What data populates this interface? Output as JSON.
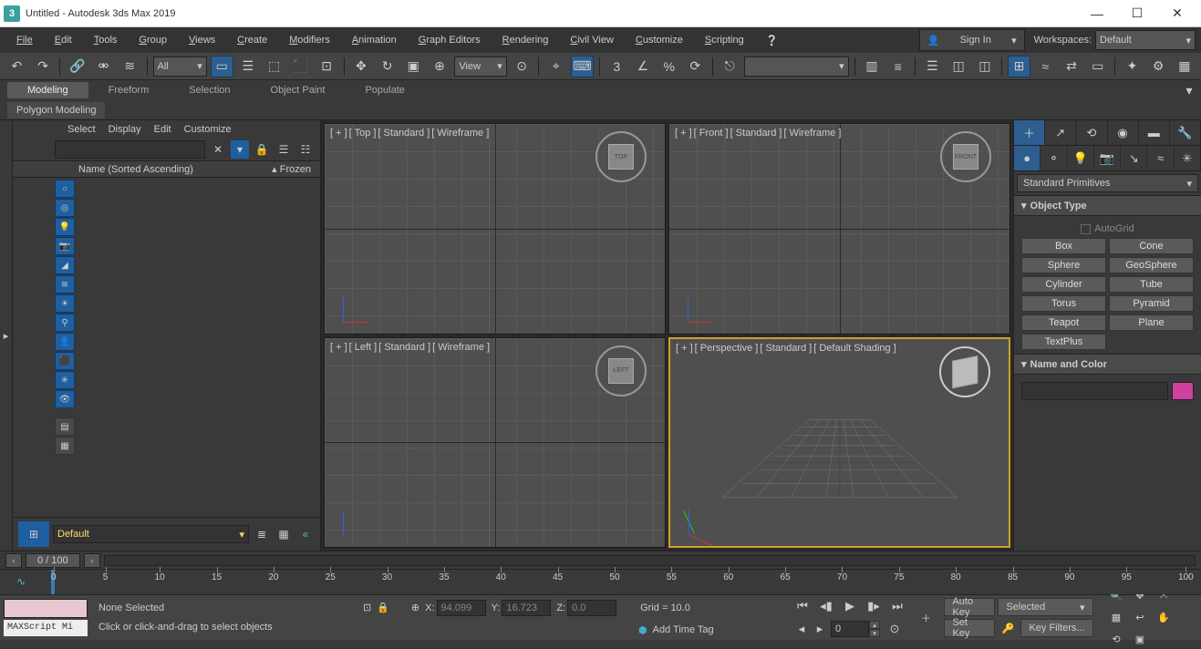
{
  "titlebar": {
    "app_icon": "3",
    "title": "Untitled - Autodesk 3ds Max 2019",
    "min": "—",
    "max": "☐",
    "close": "✕"
  },
  "menubar": {
    "items": [
      "File",
      "Edit",
      "Tools",
      "Group",
      "Views",
      "Create",
      "Modifiers",
      "Animation",
      "Graph Editors",
      "Rendering",
      "Civil View",
      "Customize",
      "Scripting"
    ],
    "help_icon": "❔",
    "signin": "Sign In",
    "ws_label": "Workspaces:",
    "ws_value": "Default"
  },
  "toolbar": {
    "undo": "↶",
    "redo": "↷",
    "link": "🔗",
    "unlink": "⚮",
    "bind": "≋",
    "filter_drop": "All",
    "select": "▭",
    "select_name": "☰",
    "rect": "⬚",
    "window": "⬛",
    "crossing": "⊡",
    "move": "✥",
    "rotate": "↻",
    "scale": "▣",
    "refcoord": "View",
    "pivot": "⊙",
    "snap_t": "⌖",
    "snap3": "3",
    "angle": "∠",
    "percent": "%",
    "spinner": "⟳",
    "curve": "⎋",
    "mirror": "▥",
    "align": "≡",
    "layers": "☰",
    "schematic": "◫",
    "material": "◐",
    "render_set": "⚙",
    "render_frame": "▭",
    "render": "▶",
    "r1": "◫",
    "r2": "≈",
    "r3": "⇄",
    "r4": "⊞",
    "r5": "✦",
    "r6": "⚙",
    "r7": "▦"
  },
  "ribbon": {
    "tabs": [
      "Modeling",
      "Freeform",
      "Selection",
      "Object Paint",
      "Populate"
    ],
    "panel": "Polygon Modeling",
    "drop_icon": "▾"
  },
  "scene_explorer": {
    "menu": [
      "Select",
      "Display",
      "Edit",
      "Customize"
    ],
    "search_ph": "",
    "clear": "✕",
    "filter": "▾",
    "lock": "🔒",
    "i1": "☰",
    "i2": "☷",
    "col_name": "Name (Sorted Ascending)",
    "col_frozen_arrow": "▴",
    "col_frozen": "Frozen",
    "left_icons": [
      "○",
      "◎",
      "💡",
      "📷",
      "◢",
      "≋",
      "☀",
      "⚲",
      "👤",
      "⬛",
      "✳",
      "👁",
      "",
      "▤",
      "▦"
    ],
    "expand": "▸",
    "vp_toggle": "⊞",
    "layer_value": "Default",
    "bi1": "≣",
    "bi2": "▦",
    "collapse": "«"
  },
  "viewports": {
    "v0": {
      "labels": [
        "[ + ]",
        "[ Top ]",
        "[ Standard ]",
        "[ Wireframe ]"
      ],
      "cube": "TOP"
    },
    "v1": {
      "labels": [
        "[ + ]",
        "[ Front ]",
        "[ Standard ]",
        "[ Wireframe ]"
      ],
      "cube": "FRONT"
    },
    "v2": {
      "labels": [
        "[ + ]",
        "[ Left ]",
        "[ Standard ]",
        "[ Wireframe ]"
      ],
      "cube": "LEFT"
    },
    "v3": {
      "labels": [
        "[ + ]",
        "[ Perspective ]",
        "[ Standard ]",
        "[ Default Shading ]"
      ]
    }
  },
  "cmd_panel": {
    "main_tabs": [
      "＋",
      "↗",
      "⟲",
      "◉",
      "▬",
      "🔧"
    ],
    "sub_tabs": [
      "●",
      "⚬",
      "💡",
      "📷",
      "↘",
      "≈",
      "✳"
    ],
    "category": "Standard Primitives",
    "rollout_objtype": "Object Type",
    "autogrid": "AutoGrid",
    "primitives": [
      "Box",
      "Cone",
      "Sphere",
      "GeoSphere",
      "Cylinder",
      "Tube",
      "Torus",
      "Pyramid",
      "Teapot",
      "Plane",
      "TextPlus"
    ],
    "rollout_namecolor": "Name and Color"
  },
  "time": {
    "back": "‹",
    "fwd": "›",
    "frame_label": "0 / 100",
    "ticks": [
      "0",
      "5",
      "10",
      "15",
      "20",
      "25",
      "30",
      "35",
      "40",
      "45",
      "50",
      "55",
      "60",
      "65",
      "70",
      "75",
      "80",
      "85",
      "90",
      "95",
      "100"
    ],
    "wave": "∿"
  },
  "status": {
    "maxscript": "MAXScript Mi",
    "sel_status": "None Selected",
    "prompt": "Click or click-and-drag to select objects",
    "lock": "🔒",
    "iso": "⊡",
    "abs": "⊕",
    "x_lbl": "X:",
    "x_val": "94.099",
    "y_lbl": "Y:",
    "y_val": "16.723",
    "z_lbl": "Z:",
    "z_val": "0.0",
    "grid_label": "Grid = 10.0",
    "addtime_icon": "⬢",
    "addtime": "Add Time Tag",
    "t_start": "⏮",
    "t_prev": "◂▮",
    "t_play": "▶",
    "t_next": "▮▸",
    "t_end": "⏭",
    "nudge_l": "◂",
    "nudge_r": "▸",
    "cur_frame": "0",
    "sel_icon": "⊙",
    "big_key": "＋",
    "autokey": "Auto Key",
    "setkey": "Set Key",
    "keymode_value": "Selected",
    "keymode_arrow": "▾",
    "kf_icon": "🔑",
    "keyfilters": "Key Filters...",
    "nav": [
      "🔍",
      "✥",
      "⤧",
      "▦",
      "↩",
      "✋",
      "⟲",
      "▣"
    ]
  }
}
